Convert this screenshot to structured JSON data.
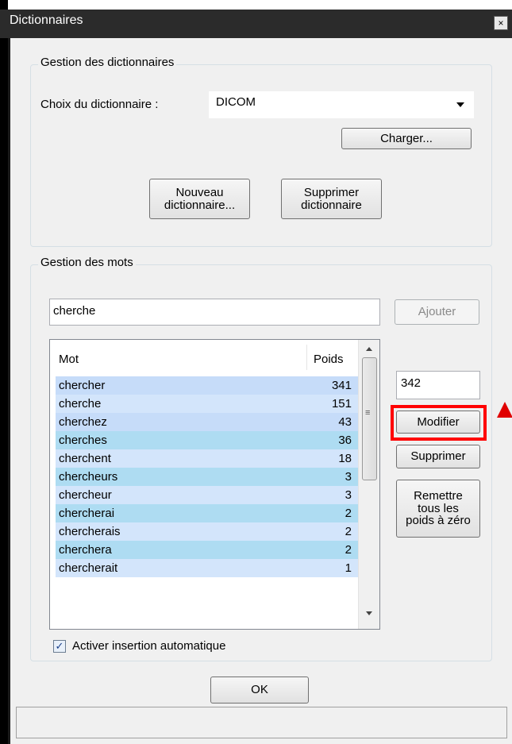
{
  "window": {
    "title": "Dictionnaires",
    "close_glyph": "×"
  },
  "dict_group": {
    "label": "Gestion des dictionnaires",
    "choice_label": "Choix du dictionnaire :",
    "selected_dictionary": "DICOM",
    "load_button": "Charger...",
    "new_button_line1": "Nouveau",
    "new_button_line2": "dictionnaire...",
    "delete_button_line1": "Supprimer",
    "delete_button_line2": "dictionnaire"
  },
  "words_group": {
    "label": "Gestion des mots",
    "search_value": "cherche",
    "add_button": "Ajouter",
    "columns": {
      "word": "Mot",
      "weight": "Poids"
    },
    "rows": [
      {
        "mot": "chercher",
        "poids": "341",
        "color": "#c6dcf9"
      },
      {
        "mot": "cherche",
        "poids": "151",
        "color": "#d3e5fb"
      },
      {
        "mot": "cherchez",
        "poids": "43",
        "color": "#c6dcf9"
      },
      {
        "mot": "cherches",
        "poids": "36",
        "color": "#aedcf2"
      },
      {
        "mot": "cherchent",
        "poids": "18",
        "color": "#d3e5fb"
      },
      {
        "mot": "chercheurs",
        "poids": "3",
        "color": "#aedcf2"
      },
      {
        "mot": "chercheur",
        "poids": "3",
        "color": "#d3e5fb"
      },
      {
        "mot": "chercherai",
        "poids": "2",
        "color": "#aedcf2"
      },
      {
        "mot": "chercherais",
        "poids": "2",
        "color": "#d3e5fb"
      },
      {
        "mot": "cherchera",
        "poids": "2",
        "color": "#aedcf2"
      },
      {
        "mot": "chercherait",
        "poids": "1",
        "color": "#d3e5fb"
      }
    ],
    "weight_value": "342",
    "modify_button": "Modifier",
    "delete_button": "Supprimer",
    "reset_line1": "Remettre",
    "reset_line2": "tous les",
    "reset_line3": "poids à zéro",
    "auto_insert_label": "Activer insertion automatique",
    "auto_insert_checked": true
  },
  "ok_button": "OK",
  "colors": {
    "highlight": "#ff0000",
    "arrow": "#e00000"
  },
  "icons": [
    "close-icon",
    "dropdown-arrow-icon",
    "scroll-up-icon",
    "scroll-down-icon",
    "scroll-grip-icon",
    "checkmark-icon",
    "red-arrow-annotation"
  ]
}
